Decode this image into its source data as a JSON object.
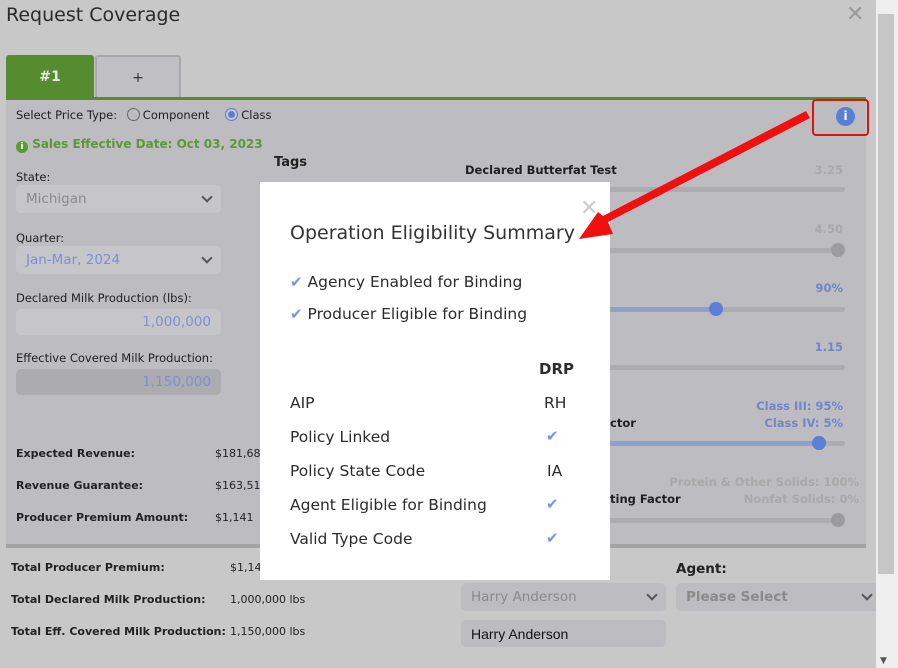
{
  "title": "Request Coverage",
  "tabs": [
    {
      "label": "#1",
      "active": true
    },
    {
      "label": "+"
    }
  ],
  "price_type": {
    "label": "Select Price Type:",
    "options": [
      "Component",
      "Class"
    ],
    "selected": "Class"
  },
  "sales_effective": "Sales Effective Date: Oct 03, 2023",
  "state": {
    "label": "State:",
    "value": "Michigan"
  },
  "quarter": {
    "label": "Quarter:",
    "value": "Jan-Mar, 2024"
  },
  "declared": {
    "label": "Declared Milk Production (lbs):",
    "value": "1,000,000"
  },
  "effective": {
    "label": "Effective Covered Milk Production:",
    "value": "1,150,000"
  },
  "tags_label": "Tags",
  "sliders": [
    {
      "label": "Declared Butterfat Test",
      "value": "3.25",
      "position": 0
    },
    {
      "label": "",
      "value": "4.50",
      "position": 1
    },
    {
      "label": "",
      "value": "90%",
      "position": 0.66
    },
    {
      "label": "",
      "value": "1.15",
      "position": 0
    },
    {
      "label": "ctor",
      "value": "Class III: 95%",
      "value2": "Class IV: 5%",
      "position": 0.95
    },
    {
      "label": "ting Factor",
      "value": "Protein & Other Solids: 100%",
      "value2": "Nonfat Solids: 0%",
      "position": 1
    }
  ],
  "stats": [
    {
      "label": "Expected Revenue:",
      "value": "$181,68"
    },
    {
      "label": "Revenue Guarantee:",
      "value": "$163,51"
    },
    {
      "label": "Producer Premium Amount:",
      "value": "$1,141"
    }
  ],
  "totals": [
    {
      "label": "Total Producer Premium:",
      "value": "$1,14"
    },
    {
      "label": "Total Declared Milk Production:",
      "value": "1,000,000 lbs"
    },
    {
      "label": "Total Eff. Covered Milk Production:",
      "value": "1,150,000 lbs"
    }
  ],
  "agency_select": "Harry Anderson",
  "agency_input": "Harry Anderson",
  "agent": {
    "label": "Agent:",
    "placeholder": "Please Select"
  },
  "modal": {
    "title": "Operation Eligibility Summary",
    "checks": [
      "Agency Enabled for Binding",
      "Producer Eligible for Binding"
    ],
    "column": "DRP",
    "rows": [
      {
        "label": "AIP",
        "value": "RH"
      },
      {
        "label": "Policy Linked",
        "value": "check"
      },
      {
        "label": "Policy State Code",
        "value": "IA"
      },
      {
        "label": "Agent Eligible for Binding",
        "value": "check"
      },
      {
        "label": "Valid Type Code",
        "value": "check"
      }
    ]
  },
  "colors": {
    "accent": "#548c2f",
    "check": "#6d97ee",
    "annotation": "#e01010",
    "slider": "#5b7fd6"
  }
}
